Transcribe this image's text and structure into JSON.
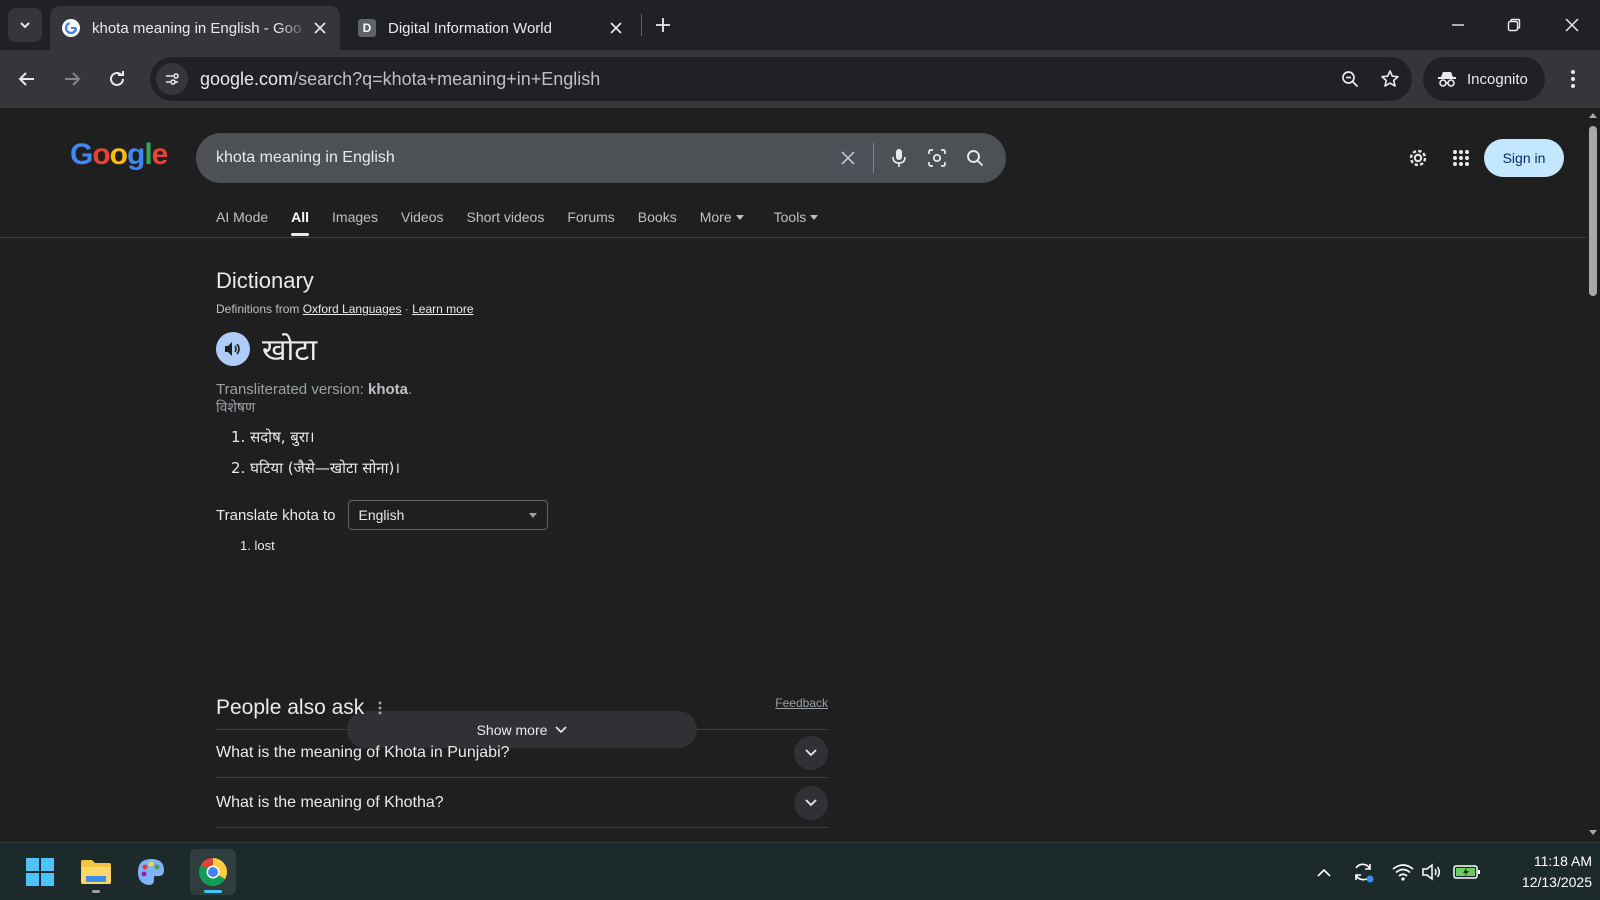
{
  "browser": {
    "tabs": [
      {
        "title": "khota meaning in English - Goo",
        "active": true,
        "favicon": "google-g-icon"
      },
      {
        "title": "Digital Information World",
        "active": false,
        "favicon": "D"
      }
    ],
    "url_host": "google.com",
    "url_path": "/search?q=khota+meaning+in+English",
    "incognito_label": "Incognito"
  },
  "google": {
    "logo": {
      "letters": [
        "G",
        "o",
        "o",
        "g",
        "l",
        "e"
      ],
      "colors": [
        "#4285f4",
        "#ea4335",
        "#fbbc05",
        "#4285f4",
        "#34a853",
        "#ea4335"
      ]
    },
    "query": "khota meaning in English",
    "signin_label": "Sign in",
    "search_tabs": [
      {
        "label": "AI Mode",
        "selected": false
      },
      {
        "label": "All",
        "selected": true
      },
      {
        "label": "Images",
        "selected": false
      },
      {
        "label": "Videos",
        "selected": false
      },
      {
        "label": "Short videos",
        "selected": false
      },
      {
        "label": "Forums",
        "selected": false
      },
      {
        "label": "Books",
        "selected": false
      },
      {
        "label": "More",
        "selected": false,
        "dropdown": true
      }
    ],
    "tools_label": "Tools"
  },
  "dictionary": {
    "heading": "Dictionary",
    "source_prefix": "Definitions from ",
    "source_link": "Oxford Languages",
    "source_sep": " · ",
    "learn_more": "Learn more",
    "word": "खोटा",
    "translit_prefix": "Transliterated version: ",
    "translit_word": "khota",
    "translit_suffix": ".",
    "part_of_speech": "विशेषण",
    "definitions": [
      "1. सदोष, बुरा।",
      "2. घटिया (जैसे—खोटा सोना)।"
    ],
    "translate_label": "Translate khota to",
    "translate_lang": "English",
    "translations": [
      "1. lost"
    ],
    "feedback": "Feedback",
    "show_more": "Show more"
  },
  "people_also_ask": {
    "heading": "People also ask",
    "questions": [
      "What is the meaning of Khota in Punjabi?",
      "What is the meaning of Khotha?"
    ]
  },
  "taskbar": {
    "time": "11:18 AM",
    "date": "12/13/2025"
  },
  "colors": {
    "accent_blue": "#8ab4f8",
    "signin_bg": "#c2e7ff",
    "taskbar_bg": "#1c2a2c"
  }
}
